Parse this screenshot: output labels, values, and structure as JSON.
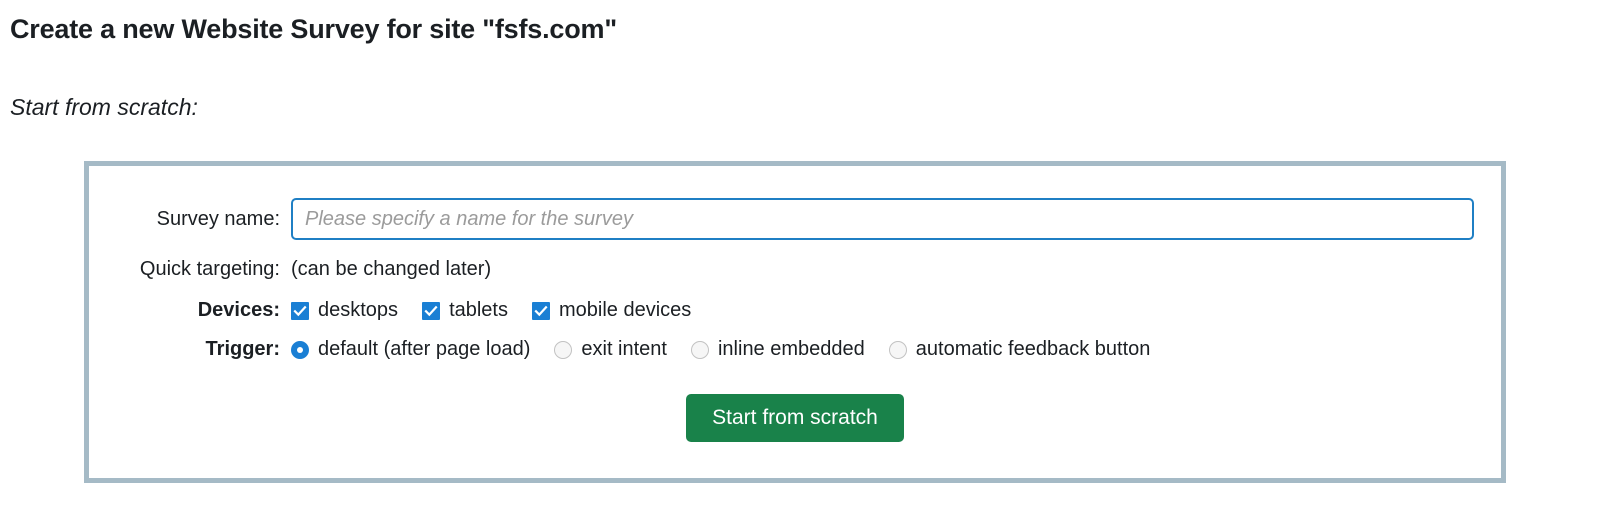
{
  "page": {
    "title": "Create a new Website Survey for site \"fsfs.com\"",
    "subtitle": "Start from scratch:"
  },
  "form": {
    "survey_name": {
      "label": "Survey name:",
      "value": "",
      "placeholder": "Please specify a name for the survey"
    },
    "quick_targeting": {
      "label": "Quick targeting:",
      "hint": "(can be changed later)"
    },
    "devices": {
      "label": "Devices:",
      "options": [
        {
          "label": "desktops",
          "checked": true
        },
        {
          "label": "tablets",
          "checked": true
        },
        {
          "label": "mobile devices",
          "checked": true
        }
      ]
    },
    "trigger": {
      "label": "Trigger:",
      "options": [
        {
          "label": "default (after page load)",
          "selected": true
        },
        {
          "label": "exit intent",
          "selected": false
        },
        {
          "label": "inline embedded",
          "selected": false
        },
        {
          "label": "automatic feedback button",
          "selected": false
        }
      ]
    },
    "submit": {
      "label": "Start from scratch"
    }
  },
  "colors": {
    "accent_blue": "#1a7fd4",
    "panel_border": "#a5bac6",
    "input_border": "#1f7fc4",
    "submit_green": "#19824a",
    "text": "#1b1f23",
    "placeholder": "#9b9b9b"
  },
  "icons": {
    "checkmark": "check-icon"
  }
}
